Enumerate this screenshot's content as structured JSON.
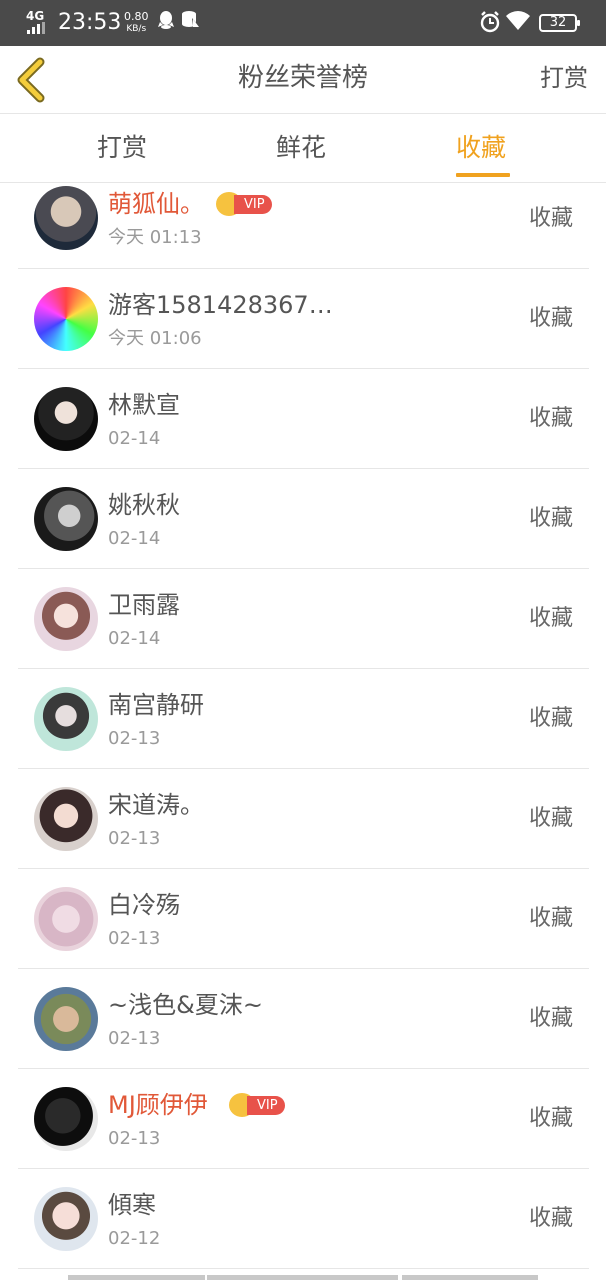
{
  "status_bar": {
    "network": "4G",
    "time": "23:53",
    "speed_value": "0.80",
    "speed_unit": "KB/s",
    "battery": "32"
  },
  "header": {
    "title": "粉丝荣誉榜",
    "right_label": "打赏"
  },
  "tabs": [
    {
      "label": "打赏",
      "active": false
    },
    {
      "label": "鲜花",
      "active": false
    },
    {
      "label": "收藏",
      "active": true
    }
  ],
  "rows": [
    {
      "name": "萌狐仙。",
      "vip": true,
      "vip_label": "VIP",
      "date": "今天 01:13",
      "action": "收藏"
    },
    {
      "name": "游客1581428367…",
      "vip": false,
      "date": "今天 01:06",
      "action": "收藏"
    },
    {
      "name": "林默宣",
      "vip": false,
      "date": "02-14",
      "action": "收藏"
    },
    {
      "name": "姚秋秋",
      "vip": false,
      "date": "02-14",
      "action": "收藏"
    },
    {
      "name": "卫雨露",
      "vip": false,
      "date": "02-14",
      "action": "收藏"
    },
    {
      "name": "南宫静研",
      "vip": false,
      "date": "02-13",
      "action": "收藏"
    },
    {
      "name": "宋道涛。",
      "vip": false,
      "date": "02-13",
      "action": "收藏"
    },
    {
      "name": "白冷殇",
      "vip": false,
      "date": "02-13",
      "action": "收藏"
    },
    {
      "name": "~浅色&夏沫~",
      "vip": false,
      "date": "02-13",
      "action": "收藏"
    },
    {
      "name": "MJ顾伊伊",
      "vip": true,
      "vip_label": "VIP",
      "date": "02-13",
      "action": "收藏"
    },
    {
      "name": "傾寒",
      "vip": false,
      "date": "02-12",
      "action": "收藏"
    }
  ],
  "colors": {
    "accent": "#f0a21f",
    "vip_name": "#e15838",
    "statusbar": "#4a4a4a"
  }
}
